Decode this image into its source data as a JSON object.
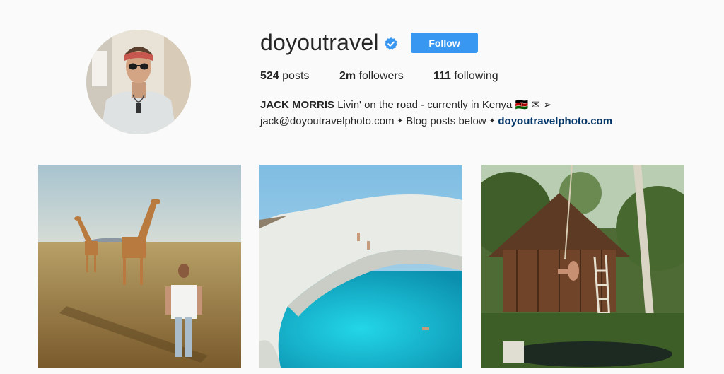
{
  "profile": {
    "username": "doyoutravel",
    "follow_label": "Follow",
    "stats": {
      "posts_count": "524",
      "posts_label": "posts",
      "followers_count": "2m",
      "followers_label": "followers",
      "following_count": "111",
      "following_label": "following"
    },
    "bio": {
      "full_name": "JACK MORRIS",
      "line1": "Livin' on the road - currently in Kenya ",
      "line1_emojis": "🇰🇪 ✉ ➢",
      "email": "jack@doyoutravelphoto.com",
      "line2": " Blog posts below ",
      "link": "doyoutravelphoto.com"
    },
    "verified_icon": "verified-badge-icon"
  },
  "colors": {
    "follow_button": "#3897f0",
    "link": "#003569",
    "verified": "#3897f0",
    "background": "#fafafa"
  },
  "posts": [
    {
      "subject": "giraffes-savanna-photo"
    },
    {
      "subject": "sea-cave-lagoon-photo"
    },
    {
      "subject": "jungle-hut-rope-swing-photo"
    }
  ]
}
